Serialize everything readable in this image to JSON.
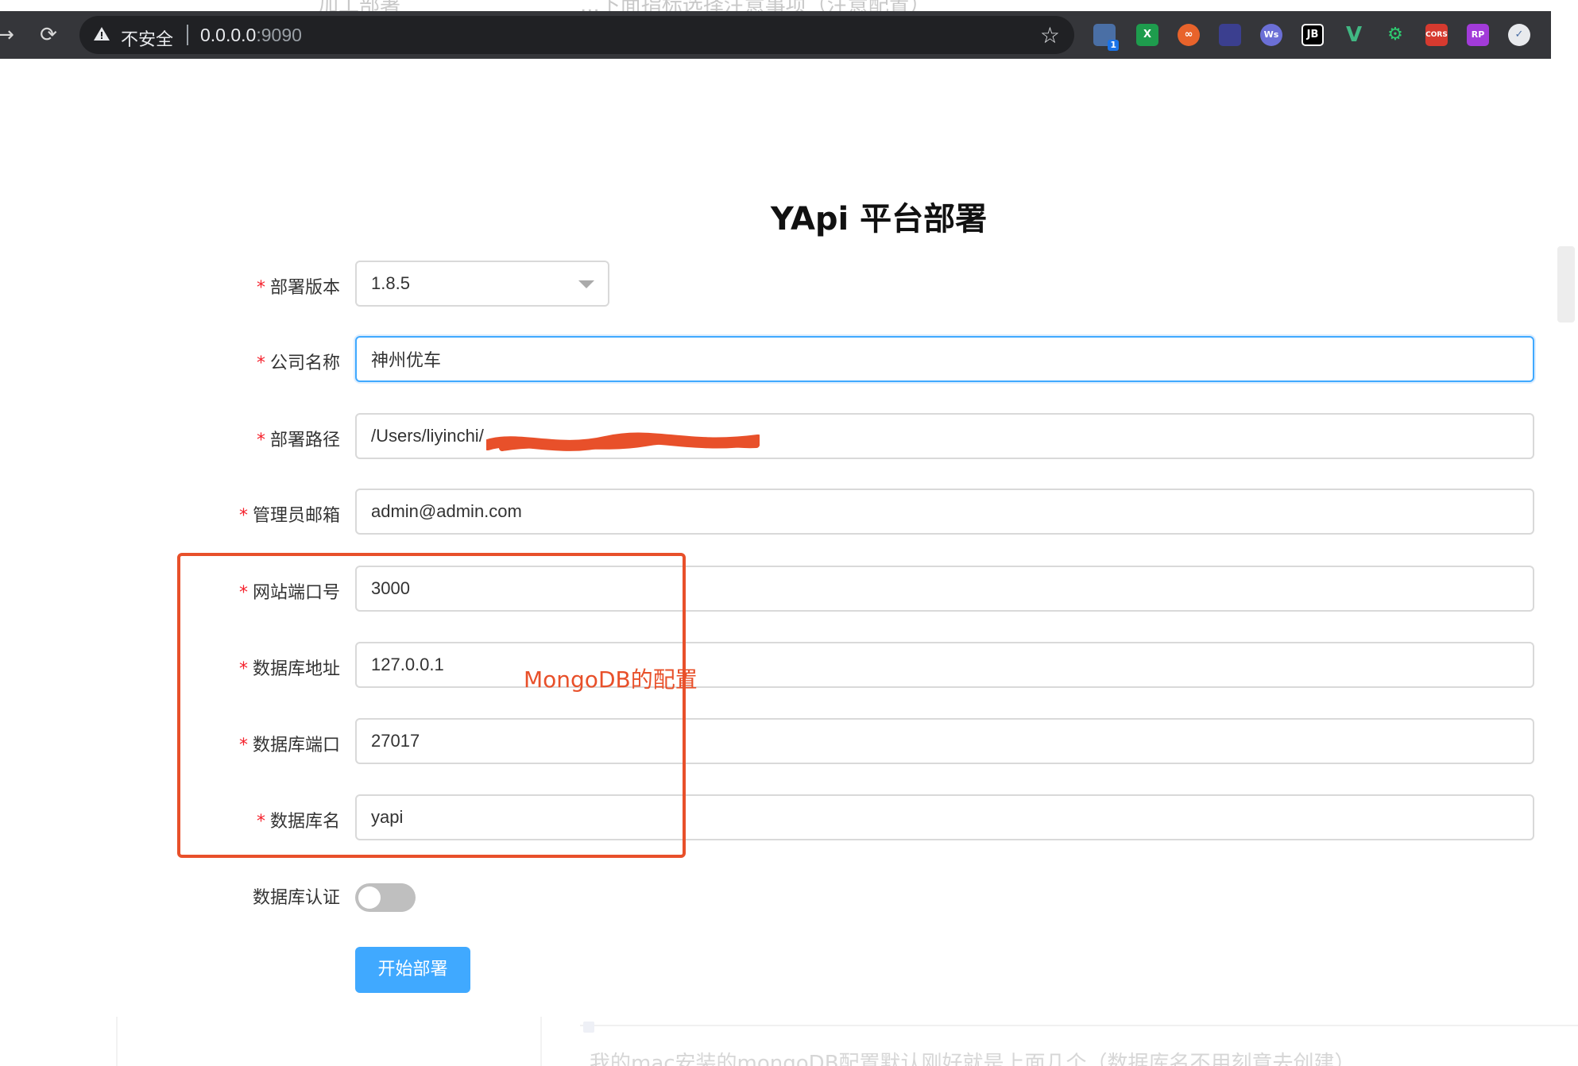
{
  "browser": {
    "security_label": "不安全",
    "url_host": "0.0.0.0",
    "url_port": ":9090",
    "extensions": [
      {
        "name": "extension-1",
        "badge": "1",
        "color": "#4a6fa5"
      },
      {
        "name": "excel-extension",
        "text": "X",
        "color": "#1e9c4d"
      },
      {
        "name": "infinity-extension",
        "text": "∞",
        "color": "#e8632b"
      },
      {
        "name": "galaxy-extension",
        "text": "",
        "color": "#3b3f8f"
      },
      {
        "name": "ws-extension",
        "text": "Ws",
        "color": "#6b6fd6"
      },
      {
        "name": "jb-extension",
        "text": "JB",
        "color": "#202124"
      },
      {
        "name": "vue-extension",
        "text": "V",
        "color": "#35363a"
      },
      {
        "name": "gear-extension",
        "text": "⚙",
        "color": "#2ecc71"
      },
      {
        "name": "cors-extension",
        "text": "CORS",
        "color": "#d63a2f"
      },
      {
        "name": "rp-extension",
        "text": "RP",
        "color": "#a23bd9"
      },
      {
        "name": "bird-extension",
        "text": "✓",
        "color": "#e8eaed"
      }
    ]
  },
  "page": {
    "title": "YApi 平台部署",
    "required_mark": "*",
    "fields": {
      "version": {
        "label": "部署版本",
        "value": "1.8.5"
      },
      "company": {
        "label": "公司名称",
        "value": "神州优车"
      },
      "path": {
        "label": "部署路径",
        "value": "/Users/liyinchi/"
      },
      "email": {
        "label": "管理员邮箱",
        "value": "admin@admin.com"
      },
      "port": {
        "label": "网站端口号",
        "value": "3000"
      },
      "db_host": {
        "label": "数据库地址",
        "value": "127.0.0.1"
      },
      "db_port": {
        "label": "数据库端口",
        "value": "27017"
      },
      "db_name": {
        "label": "数据库名",
        "value": "yapi"
      }
    },
    "db_auth": {
      "label": "数据库认证",
      "enabled": false
    },
    "deploy_button": "开始部署"
  },
  "annotation": {
    "text": "MongoDB的配置",
    "color": "#e8502a"
  },
  "bottom_note": "我的mac安装的mongoDB配置默认刚好就是上面几个（数据库名不用刻意去创建）"
}
